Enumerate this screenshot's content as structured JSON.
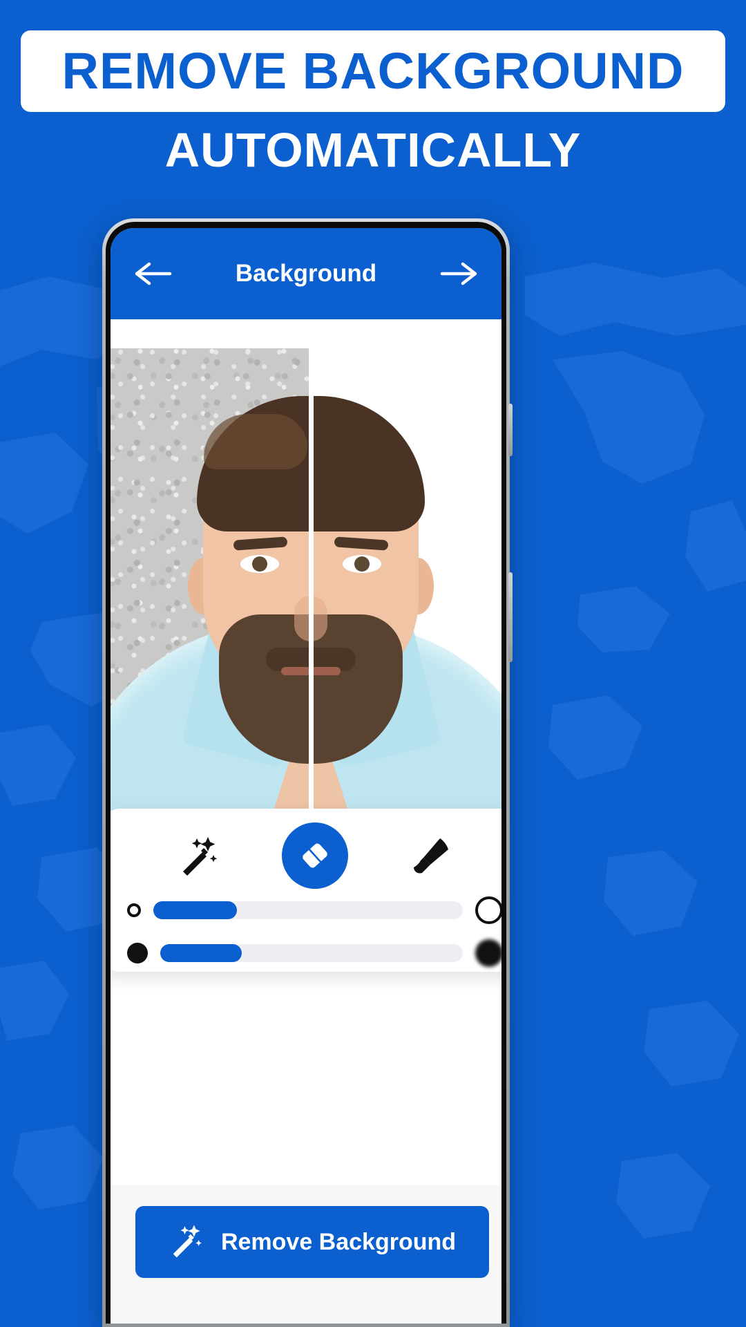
{
  "poster": {
    "background_color": "#0B5FCE",
    "headline": "REMOVE BACKGROUND",
    "headline_color": "#0B5FCE",
    "subheadline": "AUTOMATICALLY",
    "subheadline_color": "#FFFFFF"
  },
  "app": {
    "appbar": {
      "back_icon": "arrow-left-icon",
      "title": "Background",
      "forward_icon": "arrow-right-icon",
      "bar_color": "#0B5FCE",
      "text_color": "#FFFFFF"
    },
    "preview": {
      "left_label": "original-with-wall-background",
      "right_label": "background-removed-white",
      "divider": "before-after-divider"
    },
    "tools": [
      {
        "name": "magic-wand-tool",
        "icon": "magic-wand-icon",
        "selected": false
      },
      {
        "name": "eraser-tool",
        "icon": "eraser-icon",
        "selected": true
      },
      {
        "name": "brush-tool",
        "icon": "brush-icon",
        "selected": false
      }
    ],
    "sliders": [
      {
        "name": "brush-hardness-slider",
        "left_icon": "small-hollow-circle-icon",
        "right_icon": "large-hollow-circle-icon",
        "value_percent": 27,
        "fill_color": "#0B5FCE",
        "track_color": "#EDEFF2"
      },
      {
        "name": "brush-size-slider",
        "left_icon": "small-solid-dot-icon",
        "right_icon": "large-blurred-dot-icon",
        "value_percent": 27,
        "fill_color": "#0B5FCE",
        "track_color": "#EDEFF2"
      }
    ],
    "cta": {
      "icon": "magic-wand-icon",
      "label": "Remove Background",
      "color": "#0B5FCE",
      "text_color": "#FFFFFF"
    }
  }
}
